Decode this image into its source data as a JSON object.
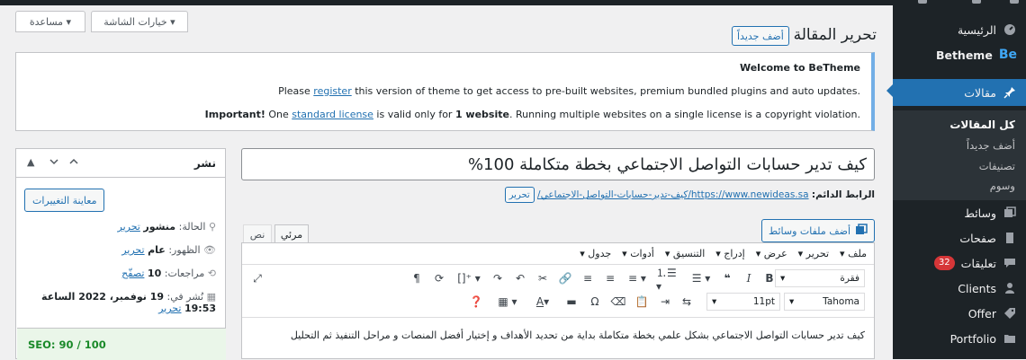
{
  "sidebar": {
    "home_label": "الرئيسية",
    "betheme_label": "Betheme",
    "betheme_logo": "Be",
    "posts_label": "مقالات",
    "posts_sub": [
      "كل المقالات",
      "أضف جديداً",
      "تصنيفات",
      "وسوم"
    ],
    "media_label": "وسائط",
    "pages_label": "صفحات",
    "comments_label": "تعليقات",
    "comments_count": "32",
    "clients_label": "Clients",
    "offer_label": "Offer",
    "portfolio_label": "Portfolio",
    "icons": {
      "home": "gauge-icon",
      "posts": "pin-icon",
      "media": "media-icon",
      "pages": "page-icon",
      "comments": "comment-icon",
      "clients": "users-icon",
      "offer": "tag-icon",
      "portfolio": "folder-icon"
    }
  },
  "header": {
    "screen_options": "خيارات الشاشة ▾",
    "help": "مساعدة ▾",
    "page_title": "تحرير المقالة",
    "add_new": "أضف جديداً"
  },
  "notice": {
    "title": "Welcome to BeTheme",
    "line1_pre": "Please ",
    "line1_link": "register",
    "line1_post": " this version of theme to get access to pre-built websites, premium bundled plugins and auto updates.",
    "line2_bold": "Important!",
    "line2_pre": " One ",
    "line2_link": "standard license",
    "line2_mid": " is valid only for ",
    "line2_bold2": "1 website",
    "line2_post": ". Running multiple websites on a single license is a copyright violation."
  },
  "publish": {
    "title": "نشر",
    "preview_button": "معاينة التغييرات",
    "status_label": "الحالة:",
    "status_value": "منشور",
    "status_edit": "تحرير",
    "visibility_label": "الظهور:",
    "visibility_value": "عام",
    "visibility_edit": "تحرير",
    "revisions_label": "مراجعات:",
    "revisions_value": "10",
    "revisions_link": "تصفّح",
    "published_label": "نُشر في:",
    "published_value": "19 نوفمبر، 2022 الساعة",
    "published_time": "19:53",
    "published_edit": "تحرير",
    "seo": "SEO: 90 / 100"
  },
  "editor": {
    "post_title": "كيف تدير حسابات التواصل الاجتماعي بخطة متكاملة 100%",
    "permalink_label": "الرابط الدائم:",
    "permalink_url": "https://www.newideas.sa/كيف-تدير-حسابات-التواصل-الاجتماعي/",
    "permalink_edit": "تحرير",
    "add_media": "أضف ملفات وسائط",
    "tab_visual": "مرئي",
    "tab_text": "نص",
    "menus": [
      "ملف ▾",
      "تحرير ▾",
      "عرض ▾",
      "إدراج ▾",
      "التنسيق ▾",
      "أدوات ▾",
      "جدول ▾"
    ],
    "format_select": "فقرة",
    "font_family": "Tahoma",
    "font_size": "11pt",
    "content": "كيف تدير حسابات التواصل الاجتماعي بشكل علمي بخطة متكاملة بداية من تحديد الأهداف و إختيار أفضل المنصات و مراحل التنفيذ ثم التحليل"
  }
}
